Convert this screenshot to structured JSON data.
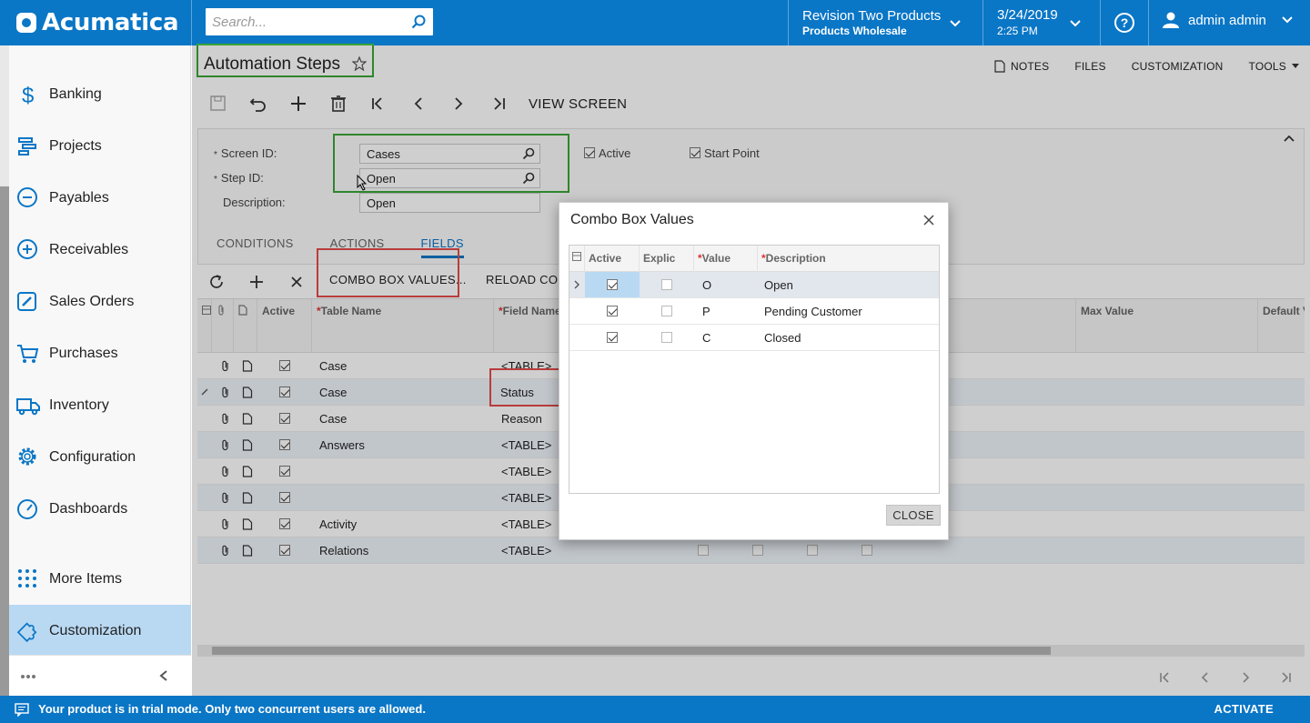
{
  "brand": {
    "name": "Acumatica"
  },
  "topbar": {
    "search_placeholder": "Search...",
    "company_name": "Revision Two Products",
    "company_branch": "Products Wholesale",
    "date": "3/24/2019",
    "time": "2:25 PM",
    "help_label": "?",
    "user_name": "admin admin"
  },
  "sidebar": {
    "items": [
      {
        "label": "Banking",
        "icon": "dollar-icon"
      },
      {
        "label": "Projects",
        "icon": "projects-icon"
      },
      {
        "label": "Payables",
        "icon": "minus-circle-icon"
      },
      {
        "label": "Receivables",
        "icon": "plus-circle-icon"
      },
      {
        "label": "Sales Orders",
        "icon": "pencil-square-icon"
      },
      {
        "label": "Purchases",
        "icon": "cart-icon"
      },
      {
        "label": "Inventory",
        "icon": "truck-icon"
      },
      {
        "label": "Configuration",
        "icon": "gear-icon"
      },
      {
        "label": "Dashboards",
        "icon": "gauge-icon"
      },
      {
        "label": "More Items",
        "icon": "grid-dots-icon"
      },
      {
        "label": "Customization",
        "icon": "puzzle-icon"
      }
    ],
    "active": "Customization"
  },
  "page": {
    "title": "Automation Steps",
    "links": {
      "notes": "NOTES",
      "files": "FILES",
      "customization": "CUSTOMIZATION",
      "tools": "TOOLS"
    },
    "toolbar": {
      "view_screen": "VIEW SCREEN"
    }
  },
  "form": {
    "screen_id_label": "Screen ID:",
    "screen_id_value": "Cases",
    "step_id_label": "Step ID:",
    "step_id_value": "Open",
    "description_label": "Description:",
    "description_value": "Open",
    "active_label": "Active",
    "start_point_label": "Start Point",
    "required_mark": "*"
  },
  "tabs": [
    {
      "label": "CONDITIONS",
      "selected": false
    },
    {
      "label": "ACTIONS",
      "selected": false
    },
    {
      "label": "FIELDS",
      "selected": true
    }
  ],
  "grid_toolbar": {
    "combo_box_values": "COMBO BOX VALUES...",
    "reload": "RELOAD CON"
  },
  "grid": {
    "columns": {
      "active": "Active",
      "table_name": "Table Name",
      "field_name": "Field Name",
      "max_value": "Max Value",
      "default_value": "Default V"
    },
    "rows": [
      {
        "table": "Case",
        "field": "<TABLE>"
      },
      {
        "table": "Case",
        "field": "Status"
      },
      {
        "table": "Case",
        "field": "Reason"
      },
      {
        "table": "Answers",
        "field": "<TABLE>"
      },
      {
        "table": "",
        "field": "<TABLE>"
      },
      {
        "table": "",
        "field": "<TABLE>"
      },
      {
        "table": "Activity",
        "field": "<TABLE>"
      },
      {
        "table": "Relations",
        "field": "<TABLE>"
      }
    ]
  },
  "dialog": {
    "title": "Combo Box Values",
    "columns": {
      "active": "Active",
      "explicit": "Explic",
      "value": "Value",
      "description": "Description"
    },
    "rows": [
      {
        "value": "O",
        "description": "Open",
        "active": true,
        "explicit": false
      },
      {
        "value": "P",
        "description": "Pending Customer",
        "active": true,
        "explicit": false
      },
      {
        "value": "C",
        "description": "Closed",
        "active": true,
        "explicit": false
      }
    ],
    "close_label": "CLOSE"
  },
  "statusbar": {
    "message": "Your product is in trial mode. Only two concurrent users are allowed.",
    "activate": "ACTIVATE"
  },
  "colors": {
    "brand_blue": "#0a76c6",
    "highlight_green": "#3aa535",
    "highlight_red": "#e54a4a",
    "selection_blue": "#b9d9f3"
  }
}
